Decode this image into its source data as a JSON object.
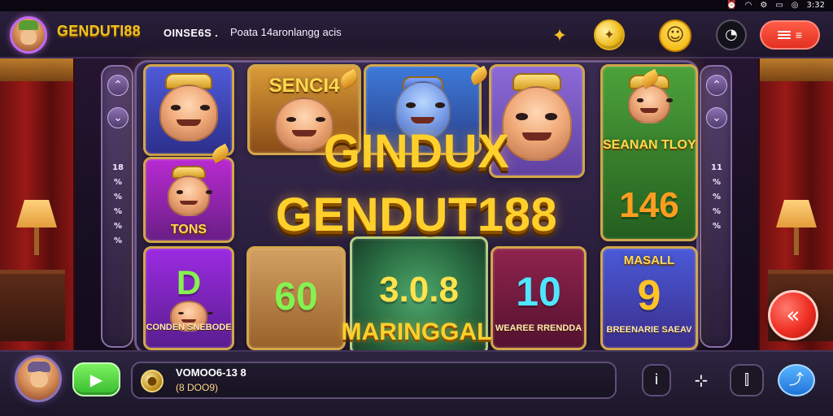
{
  "status_bar": {
    "icons": [
      "alarm-icon",
      "wifi-icon",
      "settings-icon",
      "battery-icon",
      "location-icon"
    ],
    "time": "3:32"
  },
  "header": {
    "brand": "GENDUTI88",
    "sub1": "OINSE6S .",
    "sub2": "Poata 14aronlangg acis",
    "menu_button": "≡",
    "icons": {
      "star": "star-icon",
      "coin": "coin-icon",
      "emoji": "emoji-icon",
      "headset": "headset-icon",
      "menu": "menu-icon"
    }
  },
  "side_left": {
    "labels": [
      "18",
      "%",
      "%",
      "%",
      "%",
      "%"
    ]
  },
  "side_right": {
    "labels": [
      "11",
      "%",
      "%",
      "%",
      "%"
    ]
  },
  "tiles": {
    "t1_title": "",
    "t2_title": "TONS",
    "t3_number": "D",
    "t3_footer": "CONDEN SNEBODE",
    "t4_title": "SENCI4",
    "t5_title": "",
    "t6_title": "",
    "t7_title": "SEANAN TLOY",
    "t7_number": "146",
    "t8_number": "60",
    "t9_number": "3.0.8",
    "t10_number": "10",
    "t10_footer": "WEAREE RRENDDA",
    "t11_title": "MASALL",
    "t11_number": "9",
    "t11_footer": "BREENARIE SAEAV"
  },
  "center": {
    "line1": "GINDUX",
    "line2": "GENDUT188",
    "line3": "MARINGGAL"
  },
  "bottom": {
    "info_title": "VOMOO6-13 8",
    "info_value": "(8 DOO9)",
    "buttons": {
      "play": "▶",
      "info": "i",
      "settings": "⊹",
      "bars": "⫿",
      "share": "⤴"
    }
  },
  "floating_button": "«",
  "colors": {
    "accent_gold": "#ffd02b",
    "accent_red": "#ef2e23",
    "accent_green": "#36bc2f",
    "accent_blue": "#1f73d8"
  }
}
